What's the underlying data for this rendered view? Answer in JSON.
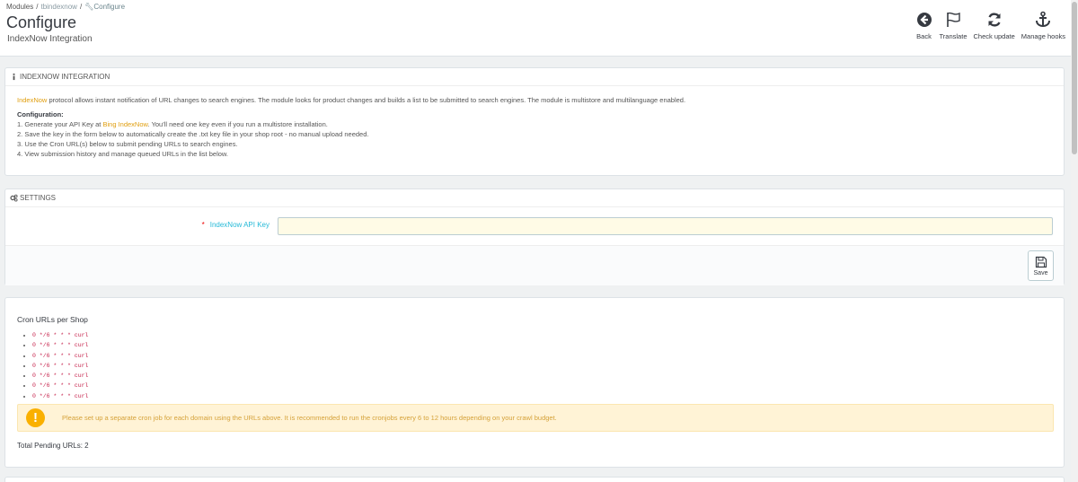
{
  "breadcrumb": [
    "Modules",
    "tbindexnow",
    "Configure"
  ],
  "header": {
    "title": "Configure",
    "subtitle": "IndexNow Integration"
  },
  "toolbar": {
    "back": "Back",
    "translate": "Translate",
    "check_update": "Check update",
    "manage_hooks": "Manage hooks"
  },
  "intro": {
    "heading": "INDEXNOW INTEGRATION",
    "link_indexnow": "IndexNow",
    "desc_rest": " protocol allows instant notification of URL changes to search engines. The module looks for product changes and builds a list to be submitted to search engines. The module is multistore and multilanguage enabled.",
    "config_title": "Configuration:",
    "step1_a": "1. Generate your API Key at ",
    "step1_link": "Bing IndexNow",
    "step1_b": ". You'll need one key even if you run a multistore installation.",
    "step2": "2. Save the key in the form below to automatically create the .txt key file in your shop root - no manual upload needed.",
    "step3": "3. Use the Cron URL(s) below to submit pending URLs to search engines.",
    "step4": "4. View submission history and manage queued URLs in the list below."
  },
  "settings": {
    "heading": "SETTINGS",
    "api_key_label": "IndexNow API Key",
    "api_key_value": "",
    "save_label": "Save"
  },
  "cron": {
    "title": "Cron URLs per Shop",
    "urls": [
      "0 */6 * * * curl",
      "0 */6 * * * curl",
      "0 */6 * * * curl",
      "0 */6 * * * curl",
      "0 */6 * * * curl",
      "0 */6 * * * curl",
      "0 */6 * * * curl"
    ],
    "alert": "Please set up a separate cron job for each domain using the URLs above. It is recommended to run the cronjobs every 6 to 12 hours depending on your crawl budget.",
    "pending": "Total Pending URLs: 2"
  },
  "colors": {
    "accent": "#25b9d7",
    "link": "#e09e0e",
    "warning": "#fab000",
    "code": "#c7254e"
  }
}
